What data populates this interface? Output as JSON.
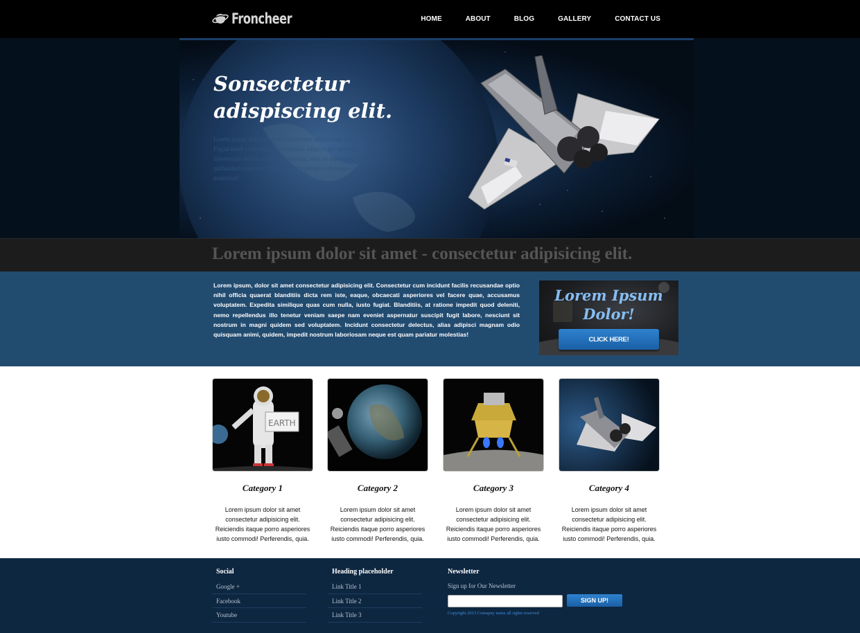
{
  "header": {
    "logo_text": "Froncheer",
    "nav": [
      "HOME",
      "ABOUT",
      "BLOG",
      "GALLERY",
      "CONTACT US"
    ]
  },
  "hero": {
    "title_line1": "Sonsectetur",
    "title_line2": "adispiscing elit.",
    "text": "Lorem ipsum dolor sit amet consectetur adipisicing elit. Fugiat modi consequatur recusandae adipisci qui aperiam laboriosam debitis, eaque assumenda, alias sit aspernatur quibusdam sapiente. Voluptate dicta perspiciatis eaque cum molestias!"
  },
  "tagline": "Lorem ipsum dolor sit amet - consectetur adipisicing elit.",
  "intro": {
    "text": "Lorem ipsum, dolor sit amet consectetur adipisicing elit. Consectetur cum incidunt facilis recusandae optio nihil officia quaerat blanditiis dicta rem iste, eaque, obcaecati asperiores vel facere quae, accusamus voluptatem. Expedita similique quas cum nulla, iusto fugiat. Blanditiis, at ratione impedit quod deleniti, nemo repellendus illo tenetur veniam saepe nam eveniet aspernatur suscipit fugit labore, nesciunt sit nostrum in magni quidem sed voluptatem. Incidunt consectetur delectus, alias adipisci magnam odio quisquam animi, quidem, impedit nostrum laboriosam neque est quam pariatur molestias!",
    "promo_title_line1": "Lorem Ipsum",
    "promo_title_line2": "Dolor!",
    "promo_button": "CLICK HERE!"
  },
  "categories": [
    {
      "title": "Category 1",
      "text": "Lorem ipsum dolor sit amet consectetur adipisicing elit. Reiciendis itaque porro asperiores iusto commodi! Perferendis, quia.",
      "image": "astronaut-earth-sign"
    },
    {
      "title": "Category 2",
      "text": "Lorem ipsum dolor sit amet consectetur adipisicing elit. Reiciendis itaque porro asperiores iusto commodi! Perferendis, quia.",
      "image": "earth-from-space"
    },
    {
      "title": "Category 3",
      "text": "Lorem ipsum dolor sit amet consectetur adipisicing elit. Reiciendis itaque porro asperiores iusto commodi! Perferendis, quia.",
      "image": "lunar-lander"
    },
    {
      "title": "Category 4",
      "text": "Lorem ipsum dolor sit amet consectetur adipisicing elit. Reiciendis itaque porro asperiores iusto commodi! Perferendis, quia.",
      "image": "space-shuttle"
    }
  ],
  "footer": {
    "social": {
      "heading": "Social",
      "links": [
        "Google +",
        "Facebook",
        "Youtube"
      ]
    },
    "placeholder": {
      "heading": "Heading placeholder",
      "links": [
        "Link Title 1",
        "Link Title 2",
        "Link Title 3"
      ]
    },
    "newsletter": {
      "heading": "Newsletter",
      "note": "Sign up for Our Newsletter",
      "input_value": "",
      "button": "SIGN UP!",
      "copyright": "Copyright 2023 Comapny name all rights reserved"
    }
  },
  "colors": {
    "header_bg": "#000000",
    "intro_bg": "#224b70",
    "footer_bg": "#0e2741",
    "accent": "#2e82cf"
  }
}
